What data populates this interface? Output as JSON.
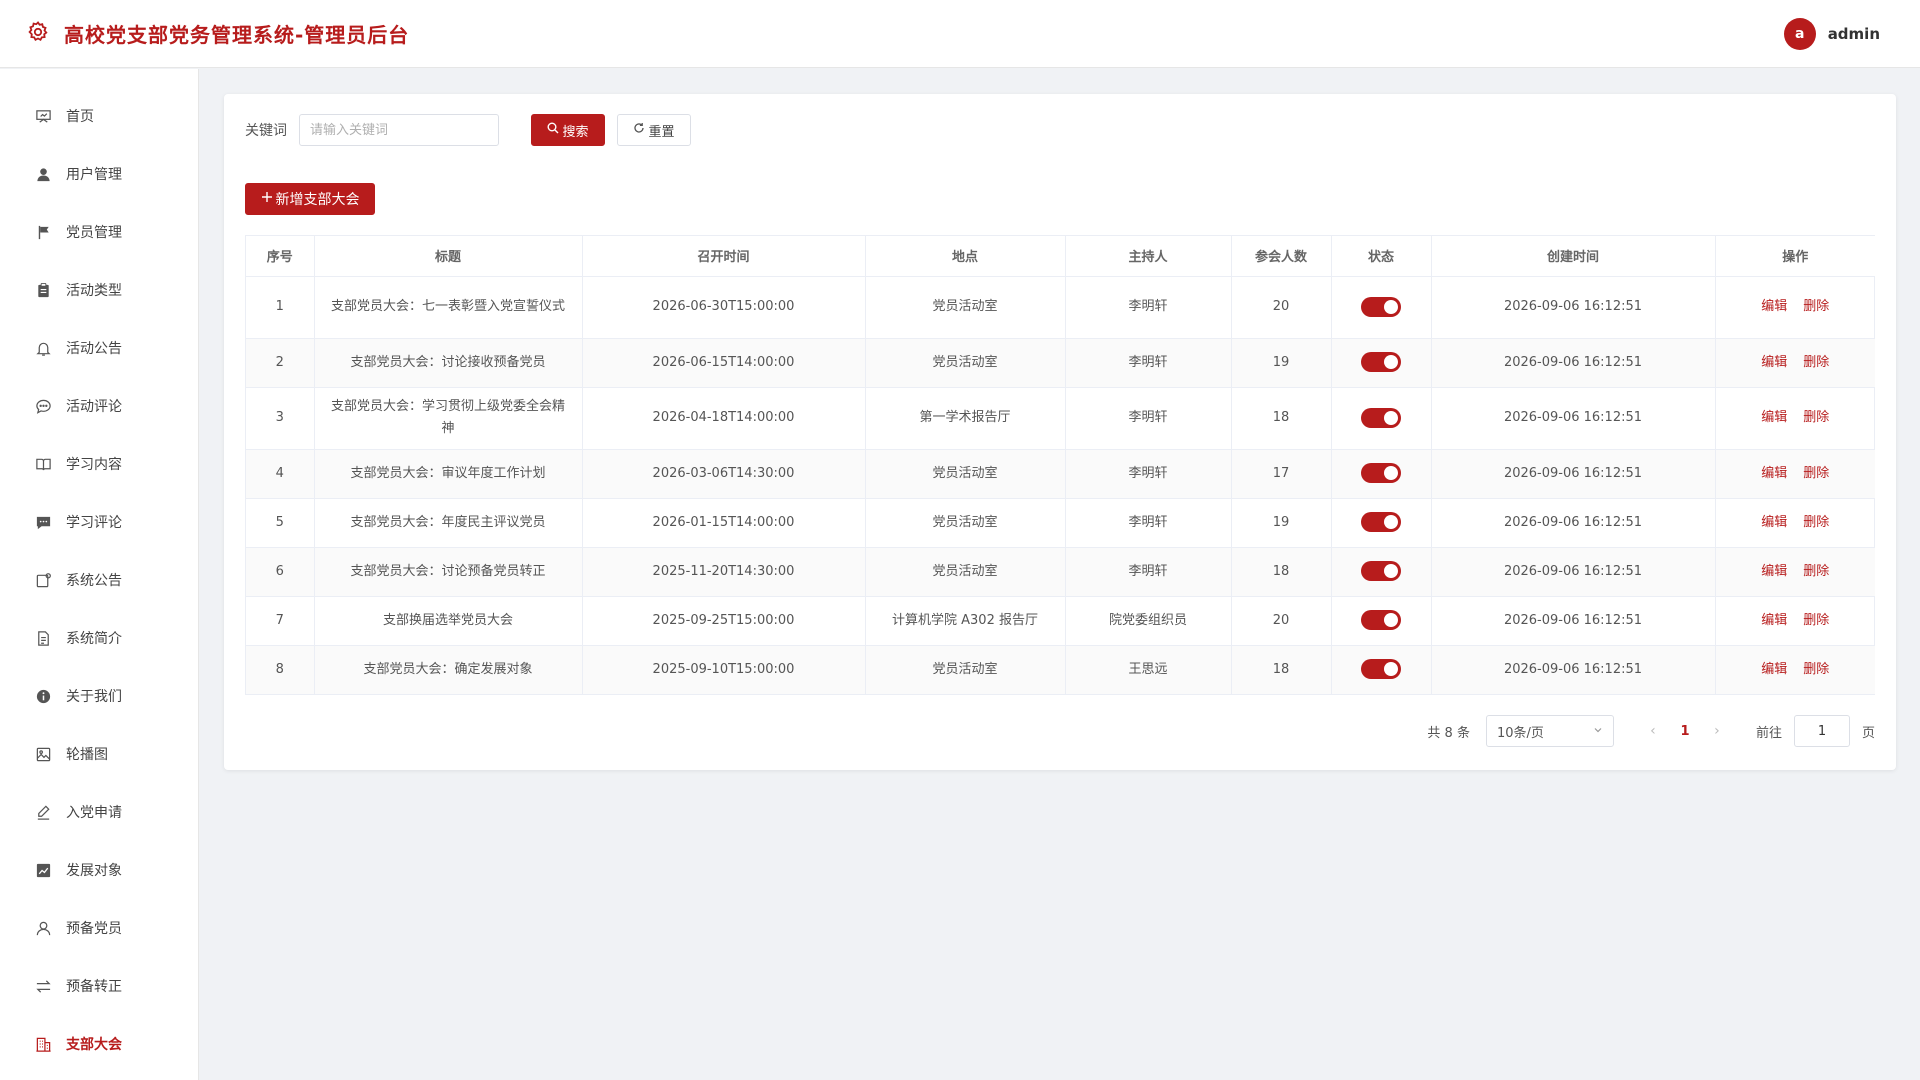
{
  "header": {
    "title": "高校党支部党务管理系统-管理员后台",
    "user": {
      "avatar_letter": "a",
      "name": "admin"
    }
  },
  "colors": {
    "accent": "#b71c1c"
  },
  "sidebar": {
    "items": [
      {
        "label": "首页",
        "icon": "presentation-icon",
        "active": false
      },
      {
        "label": "用户管理",
        "icon": "user-icon",
        "active": false
      },
      {
        "label": "党员管理",
        "icon": "flag-icon",
        "active": false
      },
      {
        "label": "活动类型",
        "icon": "clipboard-icon",
        "active": false
      },
      {
        "label": "活动公告",
        "icon": "bell-icon",
        "active": false
      },
      {
        "label": "活动评论",
        "icon": "chat-bubble-icon",
        "active": false
      },
      {
        "label": "学习内容",
        "icon": "book-icon",
        "active": false
      },
      {
        "label": "学习评论",
        "icon": "message-icon",
        "active": false
      },
      {
        "label": "系统公告",
        "icon": "notice-icon",
        "active": false
      },
      {
        "label": "系统简介",
        "icon": "document-icon",
        "active": false
      },
      {
        "label": "关于我们",
        "icon": "info-icon",
        "active": false
      },
      {
        "label": "轮播图",
        "icon": "image-icon",
        "active": false
      },
      {
        "label": "入党申请",
        "icon": "pen-icon",
        "active": false
      },
      {
        "label": "发展对象",
        "icon": "trend-icon",
        "active": false
      },
      {
        "label": "预备党员",
        "icon": "user-outline-icon",
        "active": false
      },
      {
        "label": "预备转正",
        "icon": "switch-icon",
        "active": false
      },
      {
        "label": "支部大会",
        "icon": "office-building-icon",
        "active": true
      }
    ]
  },
  "search": {
    "label": "关键词",
    "placeholder": "请输入关键词",
    "value": "",
    "search_label": "搜索",
    "reset_label": "重置"
  },
  "toolbar": {
    "add_label": "新增支部大会"
  },
  "table": {
    "columns": [
      "序号",
      "标题",
      "召开时间",
      "地点",
      "主持人",
      "参会人数",
      "状态",
      "创建时间",
      "操作"
    ],
    "rows": [
      {
        "no": "1",
        "title": "支部党员大会：七一表彰暨入党宣誓仪式",
        "time": "2026-06-30T15:00:00",
        "place": "党员活动室",
        "host": "李明轩",
        "count": "20",
        "enabled": true,
        "created": "2026-09-06 16:12:51"
      },
      {
        "no": "2",
        "title": "支部党员大会：讨论接收预备党员",
        "time": "2026-06-15T14:00:00",
        "place": "党员活动室",
        "host": "李明轩",
        "count": "19",
        "enabled": true,
        "created": "2026-09-06 16:12:51"
      },
      {
        "no": "3",
        "title": "支部党员大会：学习贯彻上级党委全会精神",
        "time": "2026-04-18T14:00:00",
        "place": "第一学术报告厅",
        "host": "李明轩",
        "count": "18",
        "enabled": true,
        "created": "2026-09-06 16:12:51"
      },
      {
        "no": "4",
        "title": "支部党员大会：审议年度工作计划",
        "time": "2026-03-06T14:30:00",
        "place": "党员活动室",
        "host": "李明轩",
        "count": "17",
        "enabled": true,
        "created": "2026-09-06 16:12:51"
      },
      {
        "no": "5",
        "title": "支部党员大会：年度民主评议党员",
        "time": "2026-01-15T14:00:00",
        "place": "党员活动室",
        "host": "李明轩",
        "count": "19",
        "enabled": true,
        "created": "2026-09-06 16:12:51"
      },
      {
        "no": "6",
        "title": "支部党员大会：讨论预备党员转正",
        "time": "2025-11-20T14:30:00",
        "place": "党员活动室",
        "host": "李明轩",
        "count": "18",
        "enabled": true,
        "created": "2026-09-06 16:12:51"
      },
      {
        "no": "7",
        "title": "支部换届选举党员大会",
        "time": "2025-09-25T15:00:00",
        "place": "计算机学院 A302 报告厅",
        "host": "院党委组织员",
        "count": "20",
        "enabled": true,
        "created": "2026-09-06 16:12:51"
      },
      {
        "no": "8",
        "title": "支部党员大会：确定发展对象",
        "time": "2025-09-10T15:00:00",
        "place": "党员活动室",
        "host": "王思远",
        "count": "18",
        "enabled": true,
        "created": "2026-09-06 16:12:51"
      }
    ],
    "edit_label": "编辑",
    "delete_label": "删除"
  },
  "pagination": {
    "total_text": "共 8 条",
    "page_size": "10条/页",
    "current_page": "1",
    "goto_label": "前往",
    "goto_value": "1",
    "page_suffix": "页"
  }
}
